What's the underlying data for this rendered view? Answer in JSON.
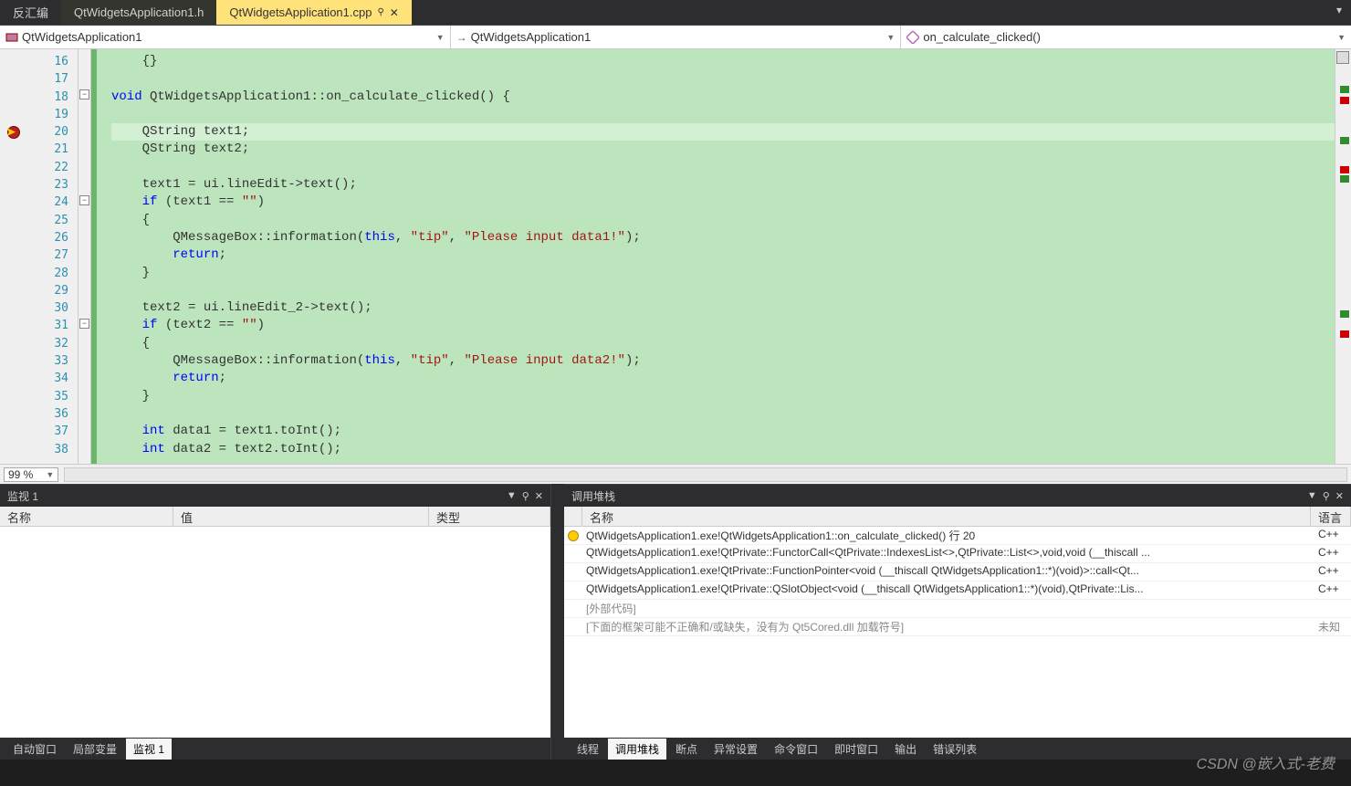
{
  "tabs": {
    "left": "反汇编",
    "file1": "QtWidgetsApplication1.h",
    "file2": "QtWidgetsApplication1.cpp"
  },
  "nav": {
    "scope": "QtWidgetsApplication1",
    "class": "QtWidgetsApplication1",
    "func": "on_calculate_clicked()"
  },
  "code": {
    "lines": [
      {
        "n": 16,
        "html": "    {}"
      },
      {
        "n": 17,
        "html": ""
      },
      {
        "n": 18,
        "html": "<span class='kw'>void</span> QtWidgetsApplication1::on_calculate_clicked() {"
      },
      {
        "n": 19,
        "html": ""
      },
      {
        "n": 20,
        "html": "    QString text1;",
        "hl": true,
        "bp": true
      },
      {
        "n": 21,
        "html": "    QString text2;"
      },
      {
        "n": 22,
        "html": ""
      },
      {
        "n": 23,
        "html": "    text1 = ui.lineEdit-&gt;text();"
      },
      {
        "n": 24,
        "html": "    <span class='kw'>if</span> (text1 == <span class='str'>\"\"</span>)"
      },
      {
        "n": 25,
        "html": "    {"
      },
      {
        "n": 26,
        "html": "        QMessageBox::information(<span class='kw'>this</span>, <span class='str'>\"tip\"</span>, <span class='str'>\"Please input data1!\"</span>);"
      },
      {
        "n": 27,
        "html": "        <span class='kw'>return</span>;"
      },
      {
        "n": 28,
        "html": "    }"
      },
      {
        "n": 29,
        "html": ""
      },
      {
        "n": 30,
        "html": "    text2 = ui.lineEdit_2-&gt;text();"
      },
      {
        "n": 31,
        "html": "    <span class='kw'>if</span> (text2 == <span class='str'>\"\"</span>)"
      },
      {
        "n": 32,
        "html": "    {"
      },
      {
        "n": 33,
        "html": "        QMessageBox::information(<span class='kw'>this</span>, <span class='str'>\"tip\"</span>, <span class='str'>\"Please input data2!\"</span>);"
      },
      {
        "n": 34,
        "html": "        <span class='kw'>return</span>;"
      },
      {
        "n": 35,
        "html": "    }"
      },
      {
        "n": 36,
        "html": ""
      },
      {
        "n": 37,
        "html": "    <span class='kw'>int</span> data1 = text1.toInt();"
      },
      {
        "n": 38,
        "html": "    <span class='kw'>int</span> data2 = text2.toInt();"
      }
    ]
  },
  "zoom": "99 %",
  "watch": {
    "title": "监视 1",
    "col_name": "名称",
    "col_value": "值",
    "col_type": "类型"
  },
  "callstack": {
    "title": "调用堆栈",
    "col_name": "名称",
    "col_lang": "语言",
    "rows": [
      {
        "current": true,
        "name": "QtWidgetsApplication1.exe!QtWidgetsApplication1::on_calculate_clicked() 行 20",
        "lang": "C++"
      },
      {
        "name": "QtWidgetsApplication1.exe!QtPrivate::FunctorCall<QtPrivate::IndexesList<>,QtPrivate::List<>,void,void (__thiscall ...",
        "lang": "C++"
      },
      {
        "name": "QtWidgetsApplication1.exe!QtPrivate::FunctionPointer<void (__thiscall QtWidgetsApplication1::*)(void)>::call<Qt...",
        "lang": "C++"
      },
      {
        "name": "QtWidgetsApplication1.exe!QtPrivate::QSlotObject<void (__thiscall QtWidgetsApplication1::*)(void),QtPrivate::Lis...",
        "lang": "C++"
      },
      {
        "ext": true,
        "name": "[外部代码]",
        "lang": ""
      },
      {
        "ext": true,
        "name": "[下面的框架可能不正确和/或缺失，没有为 Qt5Cored.dll 加载符号]",
        "lang": "未知"
      }
    ]
  },
  "bottom_tabs_left": [
    "自动窗口",
    "局部变量",
    "监视 1"
  ],
  "bottom_tabs_right": [
    "线程",
    "调用堆栈",
    "断点",
    "异常设置",
    "命令窗口",
    "即时窗口",
    "输出",
    "错误列表"
  ],
  "watermark": "CSDN @嵌入式-老费"
}
